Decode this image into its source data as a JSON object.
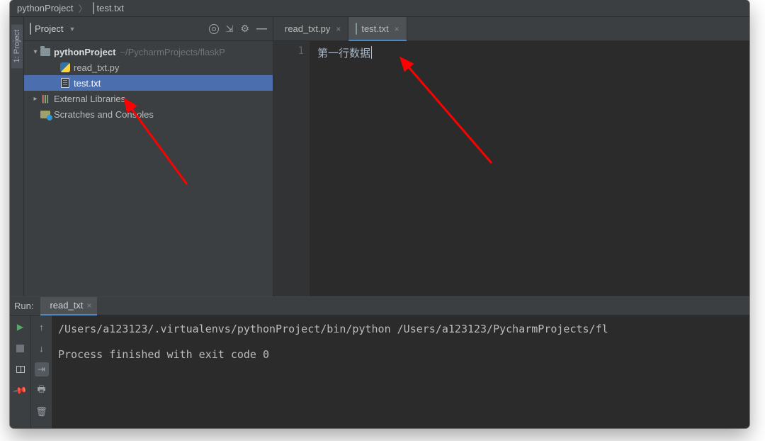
{
  "breadcrumbs": {
    "project": "pythonProject",
    "file": "test.txt"
  },
  "left_rail": {
    "project_tab": "1: Project"
  },
  "sidebar": {
    "title": "Project",
    "tree": {
      "root": {
        "name": "pythonProject",
        "path": "~/PycharmProjects/flaskP"
      },
      "files": [
        {
          "name": "read_txt.py"
        },
        {
          "name": "test.txt"
        }
      ],
      "external_libs": "External Libraries",
      "scratches": "Scratches and Consoles"
    }
  },
  "editor": {
    "tabs": [
      {
        "name": "read_txt.py",
        "active": false,
        "type": "py"
      },
      {
        "name": "test.txt",
        "active": true,
        "type": "txt"
      }
    ],
    "gutter": [
      "1"
    ],
    "content": "第一行数据"
  },
  "run": {
    "label": "Run:",
    "tab": "read_txt",
    "console_line1": "/Users/a123123/.virtualenvs/pythonProject/bin/python /Users/a123123/PycharmProjects/fl",
    "console_line2": "Process finished with exit code 0"
  }
}
